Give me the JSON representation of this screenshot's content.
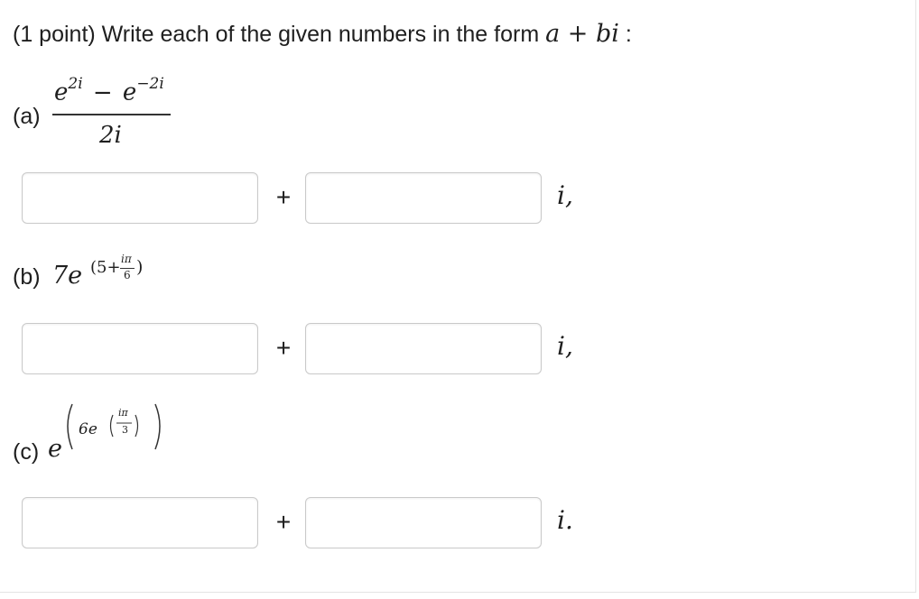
{
  "problem": {
    "title_prefix": "(1 point) Write each of the given numbers in the form",
    "form": "a + bi",
    "colon": ":"
  },
  "parts": [
    {
      "label": "(a)",
      "numerator_base1": "e",
      "numerator_exp1": "2i",
      "minus": "−",
      "numerator_base2": "e",
      "numerator_exp2": "−2i",
      "denominator": "2i",
      "real_value": "",
      "imag_value": "",
      "plus": "+",
      "suffix": "i,"
    },
    {
      "label": "(b)",
      "coef": "7e",
      "exp_open": "(5+",
      "exp_num": "iπ",
      "exp_den": "6",
      "exp_close": ")",
      "real_value": "",
      "imag_value": "",
      "plus": "+",
      "suffix": "i,"
    },
    {
      "label": "(c)",
      "base": "e",
      "inner_coef": "6e",
      "inner_num": "iπ",
      "inner_den": "3",
      "real_value": "",
      "imag_value": "",
      "plus": "+",
      "suffix": "i."
    }
  ]
}
